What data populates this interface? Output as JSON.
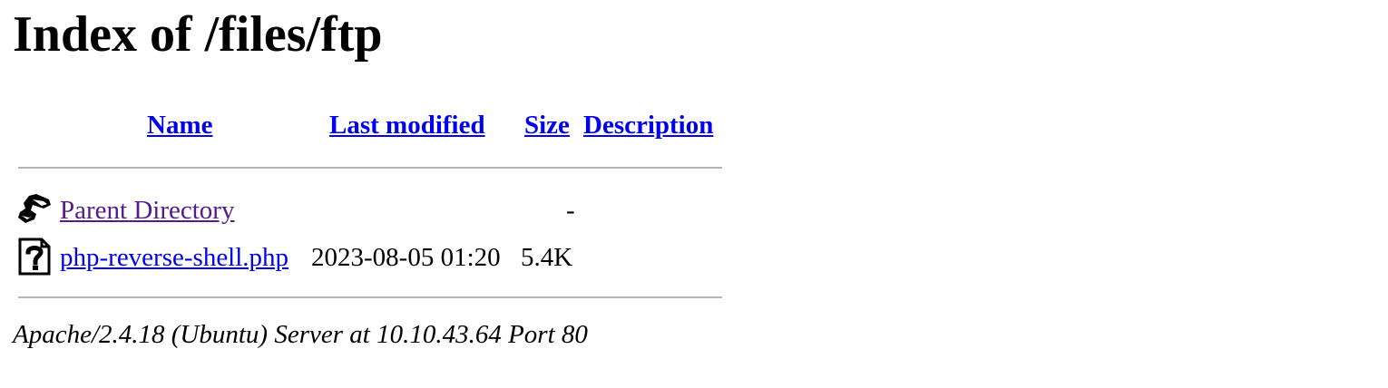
{
  "page": {
    "title": "Index of /files/ftp"
  },
  "table": {
    "headers": {
      "name": "Name",
      "last_modified": "Last modified",
      "size": "Size",
      "description": "Description"
    },
    "rows": [
      {
        "icon": "back-arrow-icon",
        "name": "Parent Directory",
        "last_modified": "",
        "size": "-",
        "description": ""
      },
      {
        "icon": "unknown-file-icon",
        "name": "php-reverse-shell.php",
        "last_modified": "2023-08-05 01:20",
        "size": "5.4K",
        "description": ""
      }
    ]
  },
  "footer": {
    "address": "Apache/2.4.18 (Ubuntu) Server at 10.10.43.64 Port 80"
  },
  "colors": {
    "link": "#0000ee",
    "visited_link": "#551a8b",
    "rule": "#b4b4b4"
  }
}
